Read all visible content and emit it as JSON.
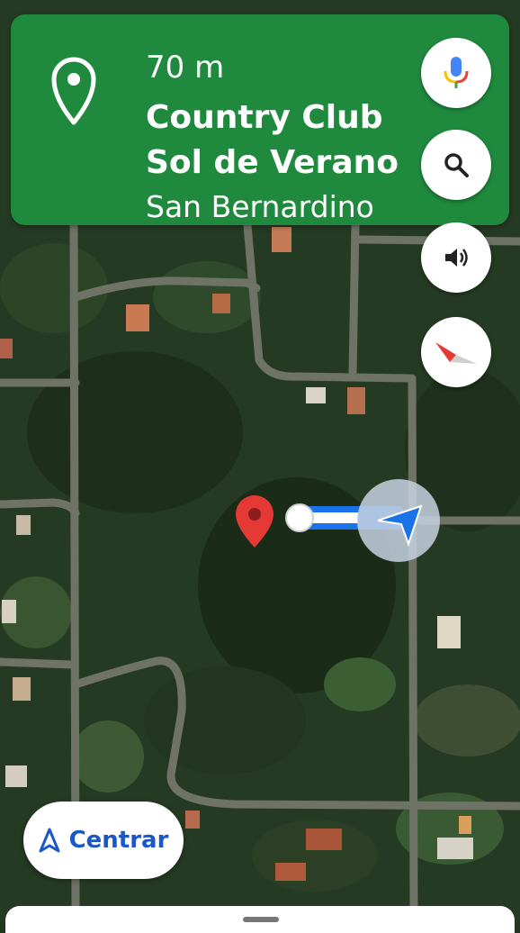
{
  "navigation": {
    "distance": "70 m",
    "street_line1": "Country Club",
    "street_line2": "Sol de Verano",
    "city": "San Bernardino",
    "banner_color": "#1f8a3d",
    "banner_icon": "location-pin-icon"
  },
  "controls": {
    "mic_icon": "microphone-icon",
    "search_icon": "search-icon",
    "sound_icon": "speaker-icon",
    "compass_icon": "compass-icon"
  },
  "recenter": {
    "label": "Centrar",
    "icon": "navigation-arrow-icon",
    "accent": "#1a57c8"
  },
  "map": {
    "type": "satellite",
    "destination_marker": "red-location-pin",
    "route_color": "#1a73e8"
  }
}
